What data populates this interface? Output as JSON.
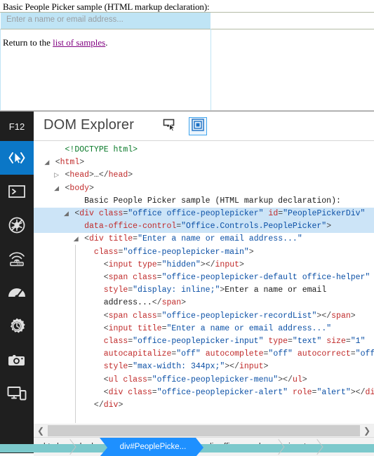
{
  "page": {
    "heading": "Basic People Picker sample (HTML markup declaration):",
    "picker_placeholder": "Enter a name or email address...",
    "return_prefix": "Return to the ",
    "return_link": "list of samples",
    "return_suffix": "."
  },
  "devtools": {
    "badge": "F12",
    "title": "DOM Explorer",
    "toolbar": [
      {
        "name": "select-element-icon",
        "label": "Select element"
      },
      {
        "name": "show-layout-icon",
        "label": "Show layout",
        "active": true
      }
    ],
    "rail": [
      {
        "name": "dom-explorer-icon",
        "label": "DOM Explorer",
        "active": true
      },
      {
        "name": "console-icon",
        "label": "Console",
        "active": false
      },
      {
        "name": "debugger-icon",
        "label": "Debugger",
        "active": false
      },
      {
        "name": "network-icon",
        "label": "Network",
        "active": false
      },
      {
        "name": "performance-icon",
        "label": "Performance",
        "active": false
      },
      {
        "name": "memory-icon",
        "label": "Memory",
        "active": false
      },
      {
        "name": "screenshot-icon",
        "label": "Screenshot",
        "active": false
      },
      {
        "name": "emulation-icon",
        "label": "Emulation",
        "active": false
      }
    ],
    "scrollbar": {
      "left_arrow": "❮",
      "right_arrow": "❯"
    },
    "breadcrumbs": [
      {
        "label": "html",
        "active": false
      },
      {
        "label": "body",
        "active": false
      },
      {
        "label": "div#PeoplePicke...",
        "active": true
      },
      {
        "label": "div.office-peopl...",
        "active": false
      },
      {
        "label": "input",
        "active": false
      }
    ],
    "dom_lines": [
      {
        "indent": 2,
        "twisty": "blank",
        "selected": false,
        "parts": [
          {
            "c": "doctype",
            "t": "<!DOCTYPE html>"
          }
        ]
      },
      {
        "indent": 1,
        "twisty": "open",
        "selected": false,
        "parts": [
          {
            "c": "punct",
            "t": "<"
          },
          {
            "c": "tag",
            "t": "html"
          },
          {
            "c": "punct",
            "t": ">"
          }
        ]
      },
      {
        "indent": 2,
        "twisty": "closed",
        "selected": false,
        "parts": [
          {
            "c": "punct",
            "t": "<"
          },
          {
            "c": "tag",
            "t": "head"
          },
          {
            "c": "punct",
            "t": ">…</"
          },
          {
            "c": "tag",
            "t": "head"
          },
          {
            "c": "punct",
            "t": ">"
          }
        ]
      },
      {
        "indent": 2,
        "twisty": "open",
        "selected": false,
        "parts": [
          {
            "c": "punct",
            "t": "<"
          },
          {
            "c": "tag",
            "t": "body"
          },
          {
            "c": "punct",
            "t": ">"
          }
        ]
      },
      {
        "indent": 4,
        "twisty": "blank",
        "selected": false,
        "parts": [
          {
            "c": "text-node",
            "t": "Basic People Picker sample (HTML markup declaration):"
          }
        ]
      },
      {
        "indent": 3,
        "twisty": "open",
        "selected": true,
        "parts": [
          {
            "c": "punct",
            "t": "<"
          },
          {
            "c": "tag",
            "t": "div"
          },
          {
            "c": "punct",
            "t": " "
          },
          {
            "c": "attr",
            "t": "class"
          },
          {
            "c": "punct",
            "t": "="
          },
          {
            "c": "val",
            "t": "\"office office-peoplepicker\""
          },
          {
            "c": "punct",
            "t": " "
          },
          {
            "c": "attr",
            "t": "id"
          },
          {
            "c": "punct",
            "t": "="
          },
          {
            "c": "val",
            "t": "\"PeoplePickerDiv\""
          }
        ]
      },
      {
        "indent": 4,
        "twisty": "blank",
        "selected": true,
        "parts": [
          {
            "c": "attr",
            "t": "data-office-control"
          },
          {
            "c": "punct",
            "t": "="
          },
          {
            "c": "val",
            "t": "\"Office.Controls.PeoplePicker\""
          },
          {
            "c": "punct",
            "t": ">"
          }
        ]
      },
      {
        "indent": 4,
        "twisty": "open",
        "selected": false,
        "parts": [
          {
            "c": "punct",
            "t": "<"
          },
          {
            "c": "tag",
            "t": "div"
          },
          {
            "c": "punct",
            "t": " "
          },
          {
            "c": "attr",
            "t": "title"
          },
          {
            "c": "punct",
            "t": "="
          },
          {
            "c": "val",
            "t": "\"Enter a name or email address...\""
          }
        ]
      },
      {
        "indent": 5,
        "twisty": "blank",
        "selected": false,
        "parts": [
          {
            "c": "attr",
            "t": "class"
          },
          {
            "c": "punct",
            "t": "="
          },
          {
            "c": "val",
            "t": "\"office-peoplepicker-main\""
          },
          {
            "c": "punct",
            "t": ">"
          }
        ]
      },
      {
        "indent": 6,
        "twisty": "blank",
        "selected": false,
        "parts": [
          {
            "c": "punct",
            "t": "<"
          },
          {
            "c": "tag",
            "t": "input"
          },
          {
            "c": "punct",
            "t": " "
          },
          {
            "c": "attr",
            "t": "type"
          },
          {
            "c": "punct",
            "t": "="
          },
          {
            "c": "val",
            "t": "\"hidden\""
          },
          {
            "c": "punct",
            "t": "></"
          },
          {
            "c": "tag",
            "t": "input"
          },
          {
            "c": "punct",
            "t": ">"
          }
        ]
      },
      {
        "indent": 6,
        "twisty": "blank",
        "selected": false,
        "parts": [
          {
            "c": "punct",
            "t": "<"
          },
          {
            "c": "tag",
            "t": "span"
          },
          {
            "c": "punct",
            "t": " "
          },
          {
            "c": "attr",
            "t": "class"
          },
          {
            "c": "punct",
            "t": "="
          },
          {
            "c": "val",
            "t": "\"office-peoplepicker-default office-helper\""
          }
        ]
      },
      {
        "indent": 6,
        "twisty": "blank",
        "selected": false,
        "parts": [
          {
            "c": "attr",
            "t": "style"
          },
          {
            "c": "punct",
            "t": "="
          },
          {
            "c": "val",
            "t": "\"display: inline;\""
          },
          {
            "c": "punct",
            "t": ">"
          },
          {
            "c": "text-node",
            "t": "Enter a name or email"
          }
        ]
      },
      {
        "indent": 6,
        "twisty": "blank",
        "selected": false,
        "parts": [
          {
            "c": "text-node",
            "t": "address..."
          },
          {
            "c": "punct",
            "t": "</"
          },
          {
            "c": "tag",
            "t": "span"
          },
          {
            "c": "punct",
            "t": ">"
          }
        ]
      },
      {
        "indent": 6,
        "twisty": "blank",
        "selected": false,
        "parts": [
          {
            "c": "punct",
            "t": "<"
          },
          {
            "c": "tag",
            "t": "span"
          },
          {
            "c": "punct",
            "t": " "
          },
          {
            "c": "attr",
            "t": "class"
          },
          {
            "c": "punct",
            "t": "="
          },
          {
            "c": "val",
            "t": "\"office-peoplepicker-recordList\""
          },
          {
            "c": "punct",
            "t": "></"
          },
          {
            "c": "tag",
            "t": "span"
          },
          {
            "c": "punct",
            "t": ">"
          }
        ]
      },
      {
        "indent": 6,
        "twisty": "blank",
        "selected": false,
        "parts": [
          {
            "c": "punct",
            "t": "<"
          },
          {
            "c": "tag",
            "t": "input"
          },
          {
            "c": "punct",
            "t": " "
          },
          {
            "c": "attr",
            "t": "title"
          },
          {
            "c": "punct",
            "t": "="
          },
          {
            "c": "val",
            "t": "\"Enter a name or email address...\""
          }
        ]
      },
      {
        "indent": 6,
        "twisty": "blank",
        "selected": false,
        "parts": [
          {
            "c": "attr",
            "t": "class"
          },
          {
            "c": "punct",
            "t": "="
          },
          {
            "c": "val",
            "t": "\"office-peoplepicker-input\""
          },
          {
            "c": "punct",
            "t": " "
          },
          {
            "c": "attr",
            "t": "type"
          },
          {
            "c": "punct",
            "t": "="
          },
          {
            "c": "val",
            "t": "\"text\""
          },
          {
            "c": "punct",
            "t": " "
          },
          {
            "c": "attr",
            "t": "size"
          },
          {
            "c": "punct",
            "t": "="
          },
          {
            "c": "val",
            "t": "\"1\""
          }
        ]
      },
      {
        "indent": 6,
        "twisty": "blank",
        "selected": false,
        "parts": [
          {
            "c": "attr",
            "t": "autocapitalize"
          },
          {
            "c": "punct",
            "t": "="
          },
          {
            "c": "val",
            "t": "\"off\""
          },
          {
            "c": "punct",
            "t": " "
          },
          {
            "c": "attr",
            "t": "autocomplete"
          },
          {
            "c": "punct",
            "t": "="
          },
          {
            "c": "val",
            "t": "\"off\""
          },
          {
            "c": "punct",
            "t": " "
          },
          {
            "c": "attr",
            "t": "autocorrect"
          },
          {
            "c": "punct",
            "t": "="
          },
          {
            "c": "val",
            "t": "\"off\""
          }
        ]
      },
      {
        "indent": 6,
        "twisty": "blank",
        "selected": false,
        "parts": [
          {
            "c": "attr",
            "t": "style"
          },
          {
            "c": "punct",
            "t": "="
          },
          {
            "c": "val",
            "t": "\"max-width: 344px;\""
          },
          {
            "c": "punct",
            "t": "></"
          },
          {
            "c": "tag",
            "t": "input"
          },
          {
            "c": "punct",
            "t": ">"
          }
        ]
      },
      {
        "indent": 6,
        "twisty": "blank",
        "selected": false,
        "parts": [
          {
            "c": "punct",
            "t": "<"
          },
          {
            "c": "tag",
            "t": "ul"
          },
          {
            "c": "punct",
            "t": " "
          },
          {
            "c": "attr",
            "t": "class"
          },
          {
            "c": "punct",
            "t": "="
          },
          {
            "c": "val",
            "t": "\"office-peoplepicker-menu\""
          },
          {
            "c": "punct",
            "t": "></"
          },
          {
            "c": "tag",
            "t": "ul"
          },
          {
            "c": "punct",
            "t": ">"
          }
        ]
      },
      {
        "indent": 6,
        "twisty": "blank",
        "selected": false,
        "parts": [
          {
            "c": "punct",
            "t": "<"
          },
          {
            "c": "tag",
            "t": "div"
          },
          {
            "c": "punct",
            "t": " "
          },
          {
            "c": "attr",
            "t": "class"
          },
          {
            "c": "punct",
            "t": "="
          },
          {
            "c": "val",
            "t": "\"office-peoplepicker-alert\""
          },
          {
            "c": "punct",
            "t": " "
          },
          {
            "c": "attr",
            "t": "role"
          },
          {
            "c": "punct",
            "t": "="
          },
          {
            "c": "val",
            "t": "\"alert\""
          },
          {
            "c": "punct",
            "t": "></"
          },
          {
            "c": "tag",
            "t": "div"
          },
          {
            "c": "punct",
            "t": ">"
          }
        ]
      },
      {
        "indent": 5,
        "twisty": "blank",
        "selected": false,
        "parts": [
          {
            "c": "punct",
            "t": "</"
          },
          {
            "c": "tag",
            "t": "div"
          },
          {
            "c": "punct",
            "t": ">"
          }
        ]
      }
    ]
  }
}
